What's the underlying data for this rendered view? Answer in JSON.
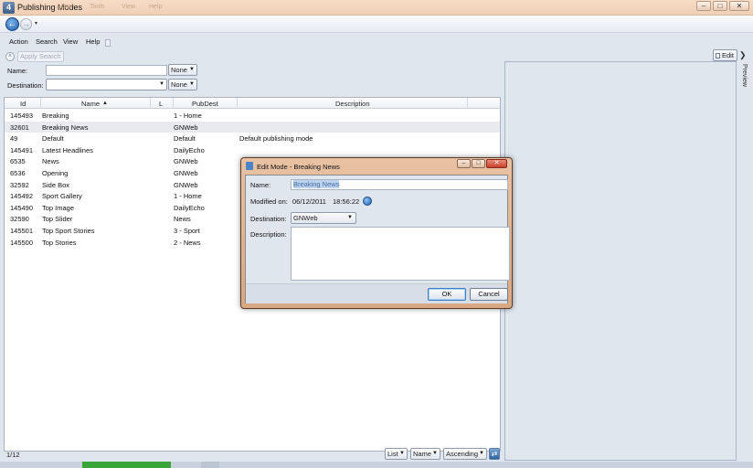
{
  "window": {
    "title": "Publishing Modes",
    "ghost_menu": [
      "Action",
      "Search",
      "Tools",
      "View",
      "Help"
    ],
    "minimize": "–",
    "maximize": "□",
    "close": "✕"
  },
  "nav": {
    "back": "←",
    "forward": "→",
    "history": "▾"
  },
  "menu": {
    "items": [
      "Action",
      "Search",
      "View",
      "Help"
    ]
  },
  "filters": {
    "apply_label": "Apply Search",
    "apply_icon": "˄",
    "name_label": "Name:",
    "name_value": "",
    "name_operator": "None",
    "destination_label": "Destination:",
    "destination_value": "",
    "destination_operator": "None"
  },
  "grid": {
    "columns": {
      "id": "Id",
      "name": "Name",
      "sort_indicator": "▲",
      "l": "L",
      "pubdest": "PubDest",
      "description": "Description"
    },
    "rows": [
      {
        "id": "145493",
        "name": "Breaking",
        "pubdest": "1 - Home",
        "description": ""
      },
      {
        "id": "32601",
        "name": "Breaking News",
        "pubdest": "GNWeb",
        "description": ""
      },
      {
        "id": "49",
        "name": "Default",
        "pubdest": "Default",
        "description": "Default publishing mode"
      },
      {
        "id": "145491",
        "name": "Latest Headlines",
        "pubdest": "DailyEcho",
        "description": ""
      },
      {
        "id": "6535",
        "name": "News",
        "pubdest": "GNWeb",
        "description": ""
      },
      {
        "id": "6536",
        "name": "Opening",
        "pubdest": "GNWeb",
        "description": ""
      },
      {
        "id": "32592",
        "name": "Side Box",
        "pubdest": "GNWeb",
        "description": ""
      },
      {
        "id": "145492",
        "name": "Sport Gallery",
        "pubdest": "1 - Home",
        "description": ""
      },
      {
        "id": "145490",
        "name": "Top Image",
        "pubdest": "DailyEcho",
        "description": ""
      },
      {
        "id": "32590",
        "name": "Top Slider",
        "pubdest": "News",
        "description": ""
      },
      {
        "id": "145501",
        "name": "Top Sport Stories",
        "pubdest": "3 - Sport",
        "description": ""
      },
      {
        "id": "145500",
        "name": "Top Stories",
        "pubdest": "2 - News",
        "description": ""
      }
    ]
  },
  "status": {
    "count": "1/12",
    "view_mode": "List",
    "sort_field": "Name",
    "sort_order": "Ascending",
    "refresh_icon": "⇄"
  },
  "preview": {
    "edit_label": "Edit",
    "expand_icon": "❯",
    "title": "Preview"
  },
  "dialog": {
    "title": "Edit Mode - Breaking News",
    "minimize": "–",
    "maximize": "□",
    "close": "✕",
    "name_label": "Name:",
    "name_value": "Breaking News",
    "modified_label": "Modified on:",
    "modified_date": "06/12/2011",
    "modified_time": "18:56:22",
    "destination_label": "Destination:",
    "destination_value": "GNWeb",
    "description_label": "Description:",
    "description_value": "",
    "ok_label": "OK",
    "cancel_label": "Cancel"
  },
  "dropdown_arrow": "▼",
  "taskbar": {
    "active_item": "",
    "other_item": ""
  }
}
